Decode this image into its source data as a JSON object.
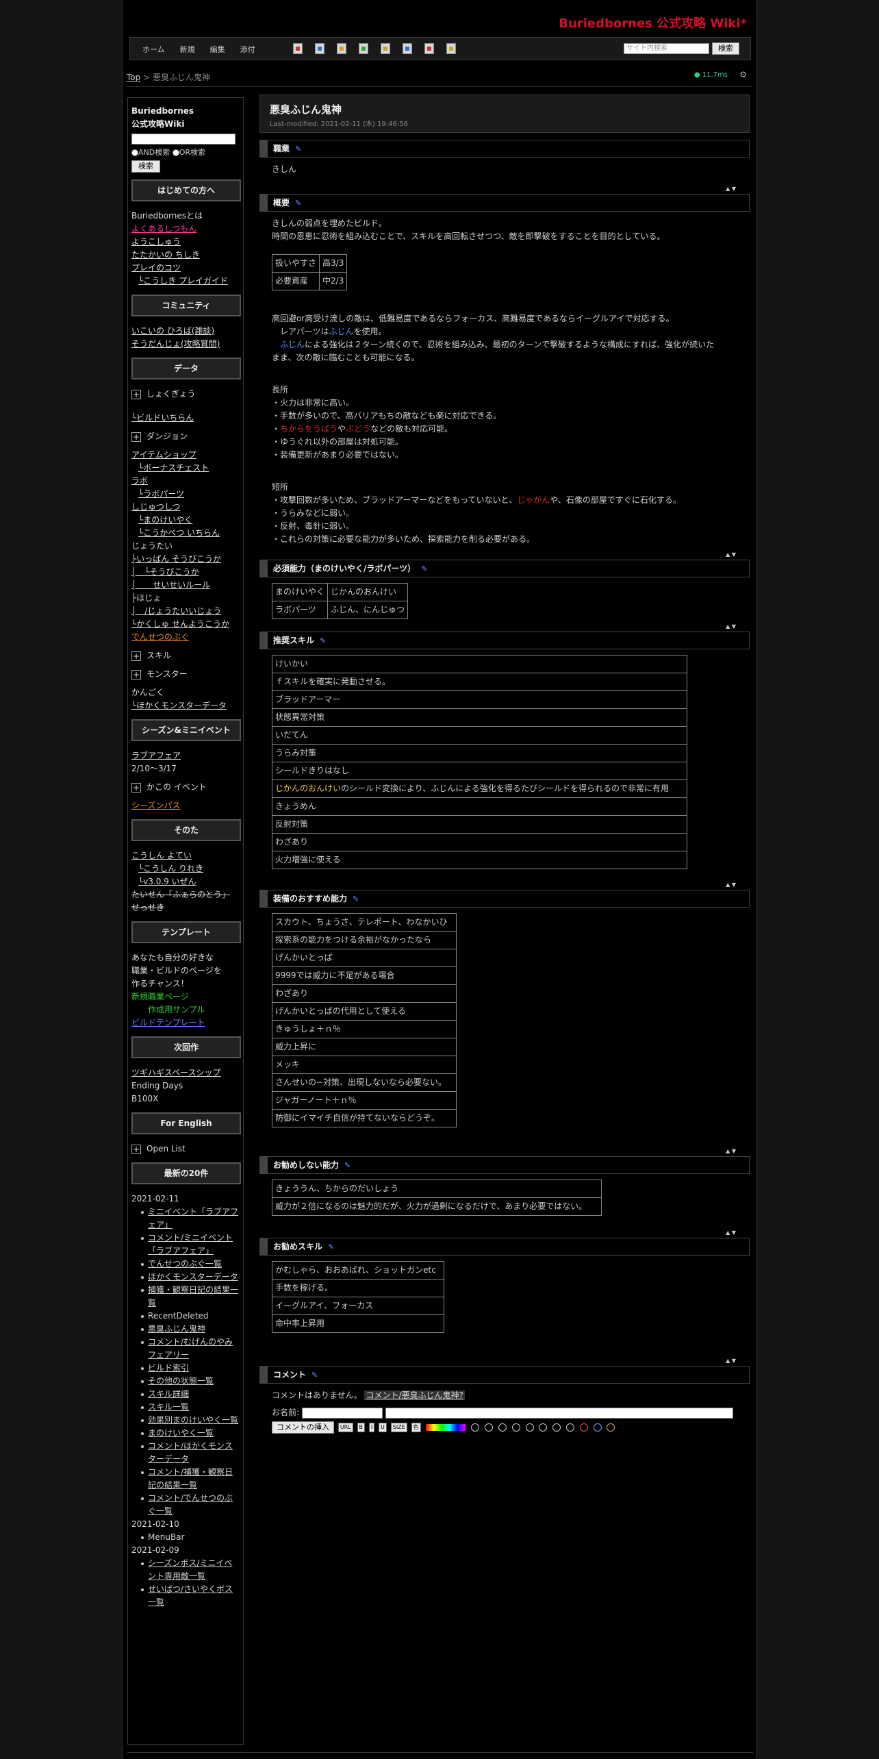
{
  "site_title": "Buriedbornes 公式攻略 Wiki*",
  "nav": {
    "links": [
      "ホーム",
      "新規",
      "編集",
      "添付"
    ],
    "search_placeholder": "サイト内検索",
    "search_button": "検索"
  },
  "breadcrumb": {
    "top": "Top",
    "sep": " > ",
    "current": "悪臭ふじん鬼神"
  },
  "perf": "11.7ms",
  "sidebar": {
    "brand1": "Buriedbornes",
    "brand2": "公式攻略Wiki",
    "and_label": "AND検索",
    "or_label": "OR検索",
    "search_button": "検索",
    "sec_intro": "はじめての方へ",
    "intro": [
      "Buriedbornesとは",
      "よくあるしつもん",
      "ようこしゅう",
      "たたかいの ちしき",
      "プレイのコツ",
      "└こうしき プレイガイド"
    ],
    "sec_community": "コミュニティ",
    "community": [
      "いこいの ひろば(雑談)",
      "そうだんじょ(攻略質問)"
    ],
    "sec_data": "データ",
    "data_a": "しょくぎょう",
    "data_b": "└ビルドいちらん",
    "data_c": "ダンジョン",
    "data_list": [
      "アイテムショップ",
      "└ボーナスチェスト",
      "ラボ",
      "└ラボパーツ",
      "しじゅつしつ",
      "└まのけいやく",
      "└こうかべつ いちらん",
      "じょうたい",
      "├いっぱん そうびこうか",
      "│　└そうびこうか",
      "│　　せいせいルール",
      "├ほじょ",
      "│　/じょうたいいじょう",
      "└かくしゅ せんようこうか"
    ],
    "data_d": "でんせつのぶぐ",
    "data_e": "スキル",
    "data_f": "モンスター",
    "data_g": [
      "かんごく",
      "└ほかくモンスターデータ"
    ],
    "sec_season": "シーズン&ミニイベント",
    "season_link": "ラブアフェア",
    "season_date": "2/10～3/17",
    "season_past": "かこの イベント",
    "season_pass": "シーズンパス",
    "sec_other": "そのた",
    "other": [
      "こうしん よてい",
      "└こうしん りれき",
      "└v3.0.9 いぜん"
    ],
    "other_strike1": "たいせん「ふぁらのとう」",
    "other_strike2": "せっせき",
    "sec_template": "テンプレート",
    "template_text": [
      "あなたも自分の好きな",
      "職業・ビルドのページを",
      "作るチャンス！"
    ],
    "template_green1": "新規職業ページ",
    "template_green2": "作成用サンプル",
    "template_blue": "ビルドテンプレート",
    "sec_next": "次回作",
    "next": [
      "ツギハギスペースシップ",
      "Ending Days",
      "B100X"
    ],
    "sec_english": "For English",
    "english_open": "Open List",
    "sec_recent": "最新の20件",
    "recent": [
      {
        "date": "2021-02-11",
        "items": [
          "ミニイベント「ラブアフェア」",
          "コメント/ミニイベント「ラブアフェア」",
          "でんせつのぶぐ一覧",
          "ほかくモンスターデータ",
          "捕獲・観察日記の結果一覧",
          "RecentDeleted",
          "悪臭ふじん鬼神",
          "コメント/むげんのやみフェアリー",
          "ビルド索引",
          "その他の状態一覧",
          "スキル詳細",
          "スキル一覧",
          "効果別まのけいやく一覧",
          "まのけいやく一覧",
          "コメント/ほかくモンスターデータ",
          "コメント/捕獲・観察日記の結果一覧",
          "コメント/でんせつのぶぐ一覧"
        ]
      },
      {
        "date": "2021-02-10",
        "items": [
          "MenuBar"
        ]
      },
      {
        "date": "2021-02-09",
        "items": [
          "シーズンボス/ミニイベント専用敵一覧",
          "せいばつ/さいやくボス一覧"
        ]
      }
    ]
  },
  "main": {
    "title": "悪臭ふじん鬼神",
    "last_modified": "Last-modified: 2021-02-11 (木) 19:46:56",
    "sec_job": "職業",
    "job": "きしん",
    "sec_overview": "概要",
    "overview_intro": [
      "きしんの弱点を埋めたビルド。",
      "時間の恩恵に忍術を組み込むことで、スキルを高回転させつつ、敵を即撃破をすることを目的としている。"
    ],
    "overview_table": [
      [
        "扱いやすさ",
        "高3/3"
      ],
      [
        "必要資産",
        "中2/3"
      ]
    ],
    "overview_body": {
      "l1": "高回避or高受け流しの敵は、低難易度であるならフォーカス、高難易度であるならイーグルアイで対応する。",
      "l2a": "レアパーツは",
      "l2b": "ふじん",
      "l2c": "を使用。",
      "l3a": "ふじん",
      "l3b": "による強化は２ターン続くので、忍術を組み込み、最初のターンで撃破するような構成にすれば、強化が続いた",
      "l4": "まま、次の敵に臨むことも可能になる。"
    },
    "merits_title": "長所",
    "merits": {
      "m1": "・火力は非常に高い。",
      "m2": "・手数が多いので、高バリアもちの敵なども楽に対応できる。",
      "m3a": "・",
      "m3b": "ちからをうばう",
      "m3c": "や",
      "m3d": "ぶどう",
      "m3e": "などの敵も対応可能。",
      "m4": "・ゆうぐれ以外の部屋は対処可能。",
      "m5": "・装備更新があまり必要ではない。"
    },
    "demerits_title": "短所",
    "demerits": {
      "d1a": "・攻撃回数が多いため、ブラッドアーマーなどをもっていないと、",
      "d1b": "じゃがん",
      "d1c": "や、石像の部屋ですぐに石化する。",
      "d2": "・うらみなどに弱い。",
      "d3": "・反射、毒針に弱い。",
      "d4": "・これらの対策に必要な能力が多いため、探索能力を削る必要がある。"
    },
    "sec_required": "必須能力（まのけいやく/ラボパーツ）",
    "required": [
      [
        "まのけいやく",
        "じかんのおんけい"
      ],
      [
        "ラボパーツ",
        "ふじん、にんじゅつ"
      ]
    ],
    "sec_skills": "推奨スキル",
    "skills": [
      "けいかい",
      "ｆスキルを確実に発動させる。",
      "ブラッドアーマー",
      "状態異常対策",
      "いだてん",
      "うらみ対策",
      "シールドきりはなし"
    ],
    "skills_special_a": "じかんのおんけい",
    "skills_special_b": "のシールド変換により、ふじんによる強化を得るたびシールドを得られるので非常に有用",
    "skills_after": [
      "きょうめん",
      "反射対策",
      "わざあり",
      "火力増強に使える"
    ],
    "sec_equip": "装備のおすすめ能力",
    "equip": [
      "スカウト、ちょうさ、テレポート、わなかいひ",
      "探索系の能力をつける余裕がなかったなら",
      "げんかいとっぱ",
      "9999では威力に不足がある場合",
      "わざあり",
      "げんかいとっぱの代用として使える",
      "きゅうしょ＋ｎ％",
      "威力上昇に",
      "メッキ",
      "さんせいの−対策、出現しないなら必要ない。",
      "ジャガーノート＋ｎ％",
      "防御にイマイチ自信が持てないならどうぞ。"
    ],
    "sec_notrec": "お勧めしない能力",
    "notrec": [
      "きょううん、ちからのだいしょう",
      "威力が２倍になるのは魅力的だが、火力が過剰になるだけで、あまり必要ではない。"
    ],
    "sec_recskill": "お勧めスキル",
    "recskill": [
      "かむしゃら、おおあばれ、ショットガンetc",
      "手数を稼げる。",
      "イーグルアイ、フォーカス",
      "命中率上昇用"
    ],
    "sec_comment": "コメント",
    "comment_none": "コメントはありません。",
    "comment_link": "コメント/悪臭ふじん鬼神?",
    "name_label": "お名前:",
    "insert_button": "コメントの挿入",
    "fmt_buttons": [
      "URL",
      "B",
      "I",
      "U",
      "SIZE",
      "色"
    ]
  }
}
